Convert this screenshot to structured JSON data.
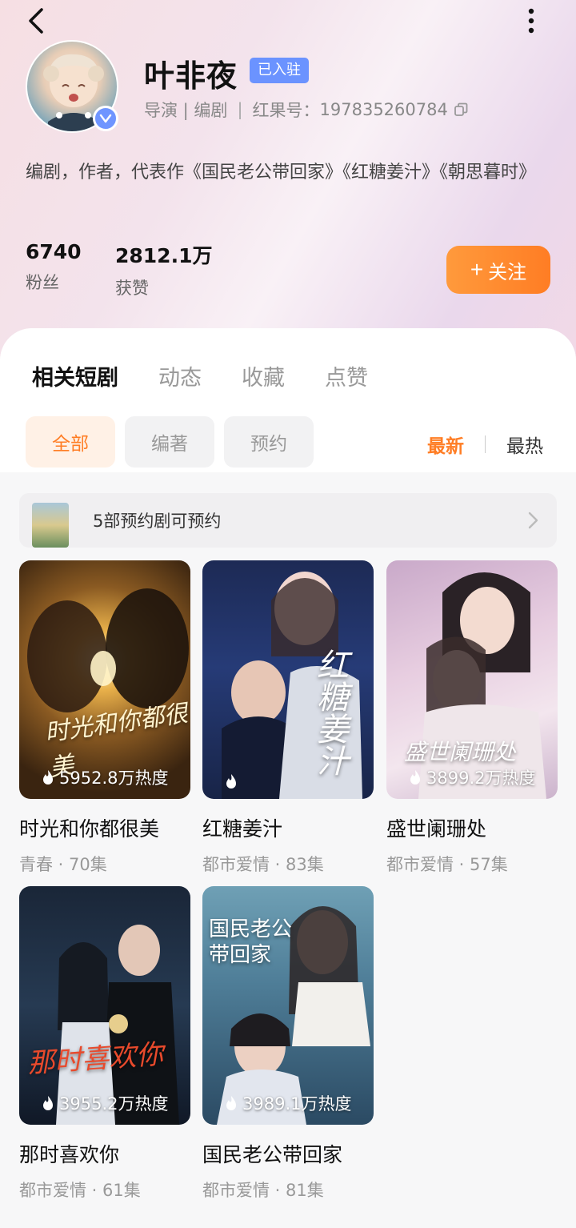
{
  "profile": {
    "name": "叶非夜",
    "badge": "已入驻",
    "roles": "导演 | 编剧",
    "id_label": "红果号：",
    "id_value": "197835260784",
    "bio": "编剧，作者，代表作《国民老公带回家》《红糖姜汁》《朝思暮时》",
    "stats": [
      {
        "value": "6740",
        "label": "粉丝"
      },
      {
        "value": "2812.1万",
        "label": "获赞"
      }
    ],
    "follow_label": "关注",
    "follow_plus": "+"
  },
  "tabs": [
    "相关短剧",
    "动态",
    "收藏",
    "点赞"
  ],
  "filters": [
    "全部",
    "编著",
    "预约"
  ],
  "sort": {
    "latest": "最新",
    "hottest": "最热"
  },
  "banner": {
    "text": "5部预约剧可预约"
  },
  "dramas": [
    {
      "title": "时光和你都很美",
      "meta": "青春 · 70集",
      "heat": "5952.8万热度",
      "poster_text": "时光和你都很美"
    },
    {
      "title": "红糖姜汁",
      "meta": "都市爱情 · 83集",
      "heat": "",
      "poster_text": "红糖姜汁"
    },
    {
      "title": "盛世阑珊处",
      "meta": "都市爱情 · 57集",
      "heat": "3899.2万热度",
      "poster_text": "盛世阑珊处"
    },
    {
      "title": "那时喜欢你",
      "meta": "都市爱情 · 61集",
      "heat": "3955.2万热度",
      "poster_text": "那时喜欢你"
    },
    {
      "title": "国民老公带回家",
      "meta": "都市爱情 · 81集",
      "heat": "3989.1万热度",
      "poster_text": "国民老公带回家"
    }
  ],
  "colors": {
    "accent": "#ff7d24",
    "badge": "#6b93ff"
  }
}
